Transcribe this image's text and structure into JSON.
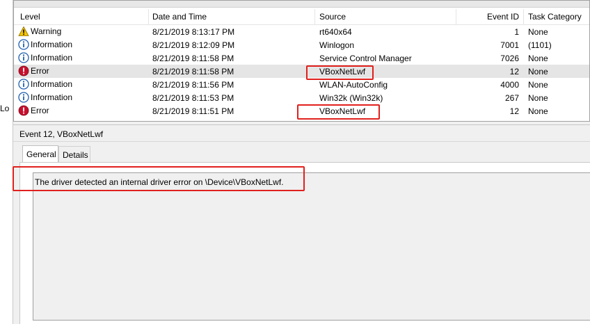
{
  "left_strip": {
    "label": "Lo"
  },
  "columns": {
    "level": "Level",
    "date": "Date and Time",
    "source": "Source",
    "event_id": "Event ID",
    "task_category": "Task Category"
  },
  "events": [
    {
      "level": "Warning",
      "icon": "warning-icon",
      "date": "8/21/2019 8:13:17 PM",
      "source": "rt640x64",
      "event_id": "1",
      "task_category": "None"
    },
    {
      "level": "Information",
      "icon": "info-icon",
      "date": "8/21/2019 8:12:09 PM",
      "source": "Winlogon",
      "event_id": "7001",
      "task_category": "(1101)"
    },
    {
      "level": "Information",
      "icon": "info-icon",
      "date": "8/21/2019 8:11:58 PM",
      "source": "Service Control Manager",
      "event_id": "7026",
      "task_category": "None"
    },
    {
      "level": "Error",
      "icon": "error-icon",
      "date": "8/21/2019 8:11:58 PM",
      "source": "VBoxNetLwf",
      "event_id": "12",
      "task_category": "None"
    },
    {
      "level": "Information",
      "icon": "info-icon",
      "date": "8/21/2019 8:11:56 PM",
      "source": "WLAN-AutoConfig",
      "event_id": "4000",
      "task_category": "None"
    },
    {
      "level": "Information",
      "icon": "info-icon",
      "date": "8/21/2019 8:11:53 PM",
      "source": "Win32k (Win32k)",
      "event_id": "267",
      "task_category": "None"
    },
    {
      "level": "Error",
      "icon": "error-icon",
      "date": "8/21/2019 8:11:51 PM",
      "source": "VBoxNetLwf",
      "event_id": "12",
      "task_category": "None"
    }
  ],
  "detail": {
    "title": "Event 12, VBoxNetLwf",
    "tabs": [
      "General",
      "Details"
    ],
    "active_tab": "General",
    "message": "The driver detected an internal driver error on \\Device\\VBoxNetLwf."
  },
  "colors": {
    "highlight": "#e0201c",
    "selected_row": "#e5e5e5",
    "warning": "#f5c400",
    "info": "#1f5fb0",
    "error": "#c8102e"
  }
}
